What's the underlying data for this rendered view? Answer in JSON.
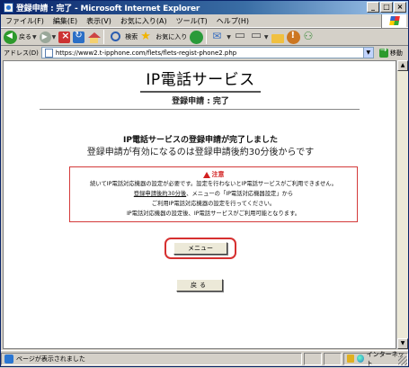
{
  "window": {
    "title": "登録申請 : 完了 - Microsoft Internet Explorer",
    "controls": [
      "_",
      "□",
      "×"
    ]
  },
  "menubar": {
    "items": [
      "ファイル(F)",
      "編集(E)",
      "表示(V)",
      "お気に入り(A)",
      "ツール(T)",
      "ヘルプ(H)"
    ]
  },
  "toolbar": {
    "back_label": "戻る",
    "search_label": "検索",
    "favorites_label": "お気に入り"
  },
  "address": {
    "label": "アドレス(D)",
    "url": "https://www2.t-ipphone.com/flets/flets-regist-phone2.php",
    "go_label": "移動"
  },
  "page": {
    "heading": "IP電話サービス",
    "subheading": "登録申請 : 完了",
    "done_line1": "IP電話サービスの登録申請が完了しました",
    "done_line2": "登録申請が有効になるのは登録申請後約30分後からです",
    "caution": {
      "title": "注意",
      "line1": "続いてIP電話対応機器の設定が必要です。設定を行わないとIP電話サービスがご利用できません。",
      "line2_link": "登録申請後約30分後",
      "line2_rest": "、メニューの「IP電話対応機器設定」から",
      "line3": "ご利用IP電話対応機器の設定を行ってください。",
      "line4": "IP電話対応機器の設定後、IP電話サービスがご利用可能となります。"
    },
    "menu_button": "メニュー",
    "back_button": "戻る"
  },
  "statusbar": {
    "status_text": "ページが表示されました",
    "zone_text": "インターネット"
  }
}
